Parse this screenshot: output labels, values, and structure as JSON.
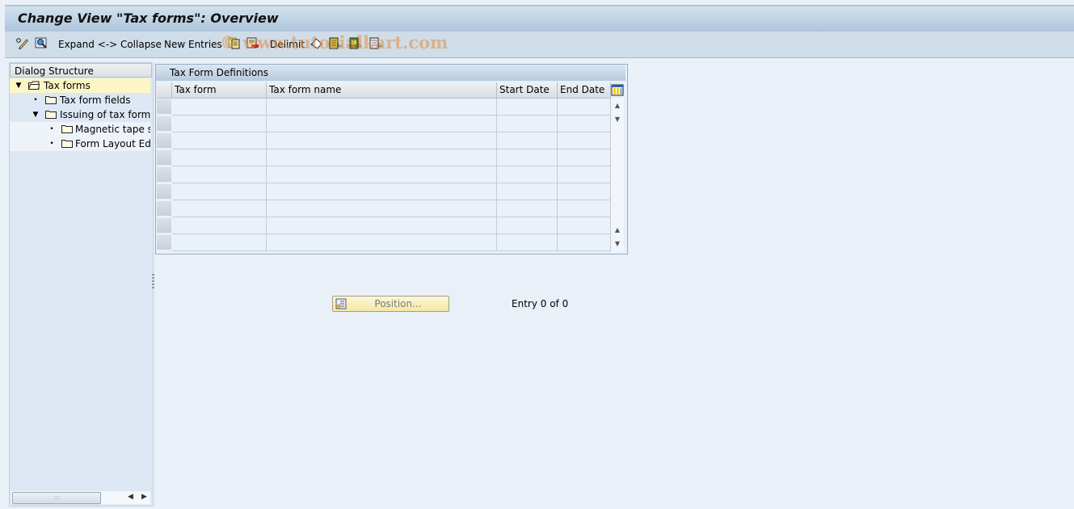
{
  "window": {
    "title": "Change View \"Tax forms\": Overview"
  },
  "toolbar": {
    "display_change_icon": "pencil-glasses-icon",
    "find_icon": "find-icon",
    "expand_collapse_label": "Expand <-> Collapse",
    "new_entries_label": "New Entries",
    "copy_icon": "copy-as-icon",
    "delete_icon": "delete-icon",
    "delimit_label": "Delimit",
    "undo_icon": "undo-change-icon",
    "select_all_icon": "select-all-icon",
    "select_block_icon": "select-block-icon",
    "deselect_all_icon": "deselect-all-icon"
  },
  "watermark": "© www.tutorialkart.com",
  "dialog_structure": {
    "header": "Dialog Structure",
    "items": [
      {
        "label": "Tax forms",
        "level": 0,
        "expanded": true,
        "selected": true,
        "icon": "open-folder-icon"
      },
      {
        "label": "Tax form fields",
        "level": 1,
        "expanded": false,
        "selected": false,
        "icon": "folder-icon"
      },
      {
        "label": "Issuing of tax forms",
        "level": 1,
        "expanded": true,
        "selected": false,
        "icon": "folder-icon"
      },
      {
        "label": "Magnetic tape st",
        "level": 2,
        "expanded": false,
        "selected": false,
        "icon": "folder-icon"
      },
      {
        "label": "Form Layout Edit",
        "level": 2,
        "expanded": false,
        "selected": false,
        "icon": "folder-icon"
      }
    ]
  },
  "table": {
    "title": "Tax Form Definitions",
    "columns": [
      "Tax form",
      "Tax form name",
      "Start Date",
      "End Date"
    ],
    "rows": [
      [
        "",
        "",
        "",
        ""
      ],
      [
        "",
        "",
        "",
        ""
      ],
      [
        "",
        "",
        "",
        ""
      ],
      [
        "",
        "",
        "",
        ""
      ],
      [
        "",
        "",
        "",
        ""
      ],
      [
        "",
        "",
        "",
        ""
      ],
      [
        "",
        "",
        "",
        ""
      ],
      [
        "",
        "",
        "",
        ""
      ],
      [
        "",
        "",
        "",
        ""
      ]
    ]
  },
  "footer": {
    "position_button_label": "Position...",
    "entry_status": "Entry 0 of 0"
  },
  "colors": {
    "title_gradient_top": "#d3e1ee",
    "title_gradient_bottom": "#adc4db",
    "toolbar_bg": "#cfdde8",
    "selected_tree_bg": "#fcf6c4",
    "content_bg": "#e9f0f8"
  }
}
